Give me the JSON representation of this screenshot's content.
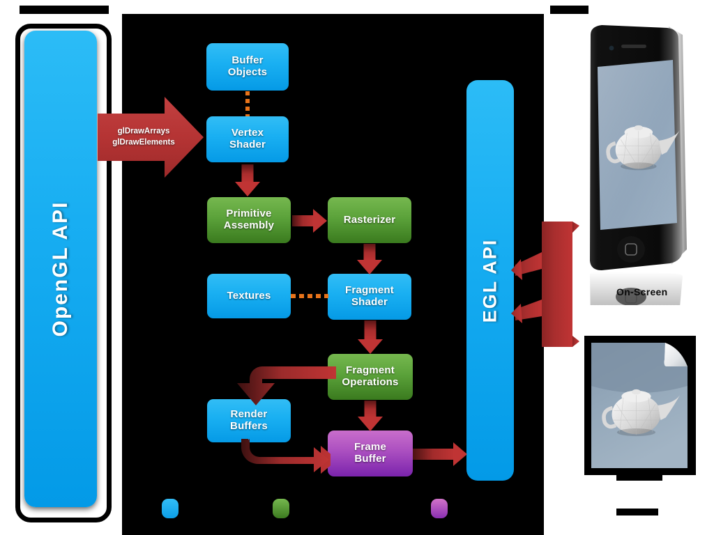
{
  "meta": {
    "title": "OpenGL ES / EGL rendering pipeline diagram",
    "background": "#ffffff"
  },
  "colors": {
    "blue_light": "#32bdf5",
    "blue_dark": "#059ae6",
    "green_light": "#76b84f",
    "green_dark": "#3a7a1e",
    "purple_light": "#c96ecb",
    "purple_dark": "#7a23ac",
    "arrow_red": "#c03434",
    "arrow_red_dark": "#4a1212",
    "dash_orange": "#e8731a",
    "panel_black": "#000000"
  },
  "rails": {
    "opengl": {
      "label": "OpenGL API",
      "color": "#1ab0f2"
    },
    "egl": {
      "label": "EGL API",
      "color": "#1ab0f2"
    }
  },
  "draw_arrow": {
    "line1": "glDrawArrays",
    "line2": "glDrawElements"
  },
  "nodes": [
    {
      "id": "buffer-objects",
      "line1": "Buffer",
      "line2": "Objects",
      "color": "blue"
    },
    {
      "id": "vertex-shader",
      "line1": "Vertex",
      "line2": "Shader",
      "color": "blue"
    },
    {
      "id": "primitive-assembly",
      "line1": "Primitive",
      "line2": "Assembly",
      "color": "green"
    },
    {
      "id": "rasterizer",
      "line1": "Rasterizer",
      "line2": "",
      "color": "green"
    },
    {
      "id": "textures",
      "line1": "Textures",
      "line2": "",
      "color": "blue"
    },
    {
      "id": "fragment-shader",
      "line1": "Fragment",
      "line2": "Shader",
      "color": "blue"
    },
    {
      "id": "fragment-operations",
      "line1": "Fragment",
      "line2": "Operations",
      "color": "green"
    },
    {
      "id": "render-buffers",
      "line1": "Render",
      "line2": "Buffers",
      "color": "blue"
    },
    {
      "id": "frame-buffer",
      "line1": "Frame",
      "line2": "Buffer",
      "color": "purple"
    }
  ],
  "legend": [
    {
      "id": "legend-blue",
      "color": "#15adf1",
      "label": ""
    },
    {
      "id": "legend-green",
      "color": "#55a03a",
      "label": ""
    },
    {
      "id": "legend-purple",
      "color": "#a44bbd",
      "label": ""
    }
  ],
  "outputs": {
    "on_screen": {
      "label": "On-Screen",
      "device": "smartphone showing rendered teapot"
    },
    "off_screen": {
      "label": "",
      "device": "file/document page showing rendered teapot"
    }
  }
}
